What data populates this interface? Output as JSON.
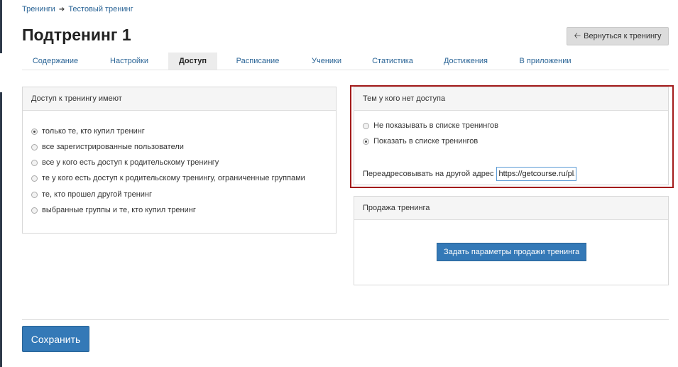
{
  "breadcrumb": {
    "items": [
      "Тренинги",
      "Тестовый тренинг"
    ],
    "separator": "➔"
  },
  "page": {
    "title": "Подтренинг 1",
    "back_button": "Вернуться к тренингу"
  },
  "tabs": [
    {
      "label": "Содержание",
      "active": false
    },
    {
      "label": "Настройки",
      "active": false
    },
    {
      "label": "Доступ",
      "active": true
    },
    {
      "label": "Расписание",
      "active": false
    },
    {
      "label": "Ученики",
      "active": false
    },
    {
      "label": "Статистика",
      "active": false
    },
    {
      "label": "Достижения",
      "active": false
    },
    {
      "label": "В приложении",
      "active": false
    }
  ],
  "access_panel": {
    "title": "Доступ к тренингу имеют",
    "options": [
      {
        "label": "только те, кто купил тренинг",
        "checked": true
      },
      {
        "label": "все зарегистрированные пользователи",
        "checked": false
      },
      {
        "label": "все у кого есть доступ к родительскому тренингу",
        "checked": false
      },
      {
        "label": "те у кого есть доступ к родительскому тренингу, ограниченные группами",
        "checked": false
      },
      {
        "label": "те, кто прошел другой тренинг",
        "checked": false
      },
      {
        "label": "выбранные группы и те, кто купил тренинг",
        "checked": false
      }
    ]
  },
  "no_access_panel": {
    "title": "Тем у кого нет доступа",
    "options": [
      {
        "label": "Не показывать в списке тренингов",
        "checked": false
      },
      {
        "label": "Показать в списке тренингов",
        "checked": true
      }
    ],
    "redirect_label": "Переадресовывать на другой адрес",
    "redirect_value": "https://getcourse.ru/pl/"
  },
  "sale_panel": {
    "title": "Продажа тренинга",
    "button": "Задать параметры продажи тренинга"
  },
  "save_button": "Сохранить",
  "colors": {
    "link": "#2a6496",
    "primary_button": "#3479b7",
    "highlight_outline": "#a31b1b"
  }
}
